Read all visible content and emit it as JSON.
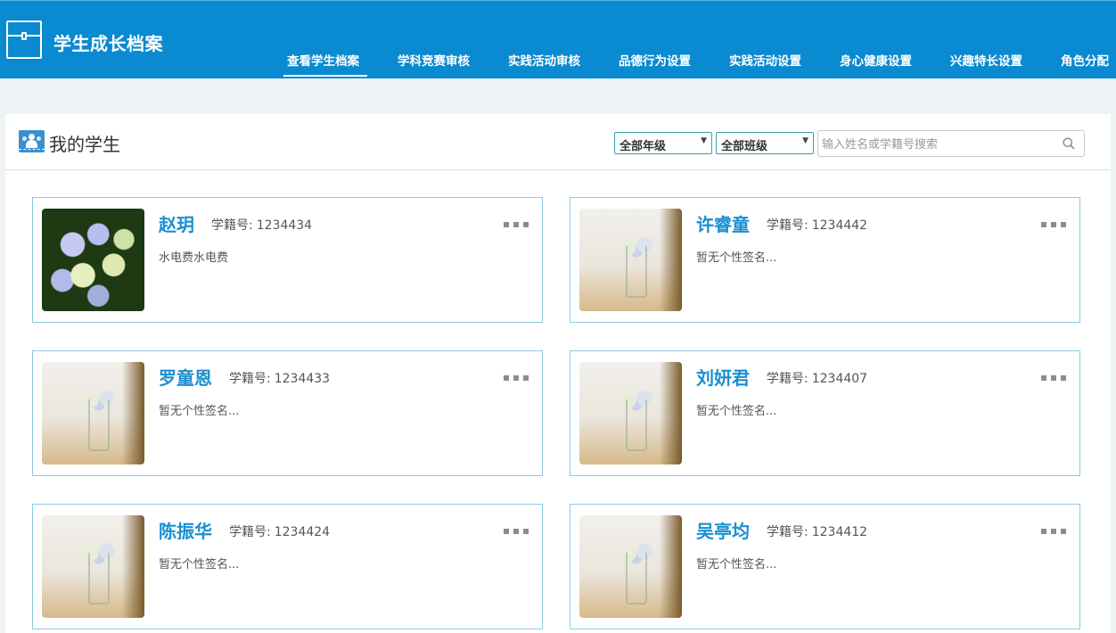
{
  "header": {
    "app_title": "学生成长档案",
    "nav": [
      {
        "label": "查看学生档案",
        "active": true
      },
      {
        "label": "学科竞赛审核",
        "active": false
      },
      {
        "label": "实践活动审核",
        "active": false
      },
      {
        "label": "品德行为设置",
        "active": false
      },
      {
        "label": "实践活动设置",
        "active": false
      },
      {
        "label": "身心健康设置",
        "active": false
      },
      {
        "label": "兴趣特长设置",
        "active": false
      },
      {
        "label": "角色分配",
        "active": false
      }
    ]
  },
  "panel": {
    "title": "我的学生",
    "filters": {
      "grade_selected": "全部年级",
      "class_selected": "全部班级",
      "search_placeholder": "输入姓名或学籍号搜索",
      "search_value": ""
    }
  },
  "student_id_label": "学籍号:",
  "students": [
    {
      "name": "赵玥",
      "id": "1234434",
      "signature": "水电费水电费",
      "photo": "hydrangea-photo"
    },
    {
      "name": "许睿童",
      "id": "1234442",
      "signature": "暂无个性签名...",
      "photo": "flower-vase-photo"
    },
    {
      "name": "罗童恩",
      "id": "1234433",
      "signature": "暂无个性签名...",
      "photo": "flower-vase-photo"
    },
    {
      "name": "刘妍君",
      "id": "1234407",
      "signature": "暂无个性签名...",
      "photo": "flower-vase-photo"
    },
    {
      "name": "陈振华",
      "id": "1234424",
      "signature": "暂无个性签名...",
      "photo": "flower-vase-photo"
    },
    {
      "name": "吴亭均",
      "id": "1234412",
      "signature": "暂无个性签名...",
      "photo": "flower-vase-photo"
    }
  ],
  "colors": {
    "header_bg": "#0a8ad0",
    "page_bg": "#edf2f5",
    "name_blue": "#1a8fd0",
    "card_border": "#8ec9e8"
  }
}
